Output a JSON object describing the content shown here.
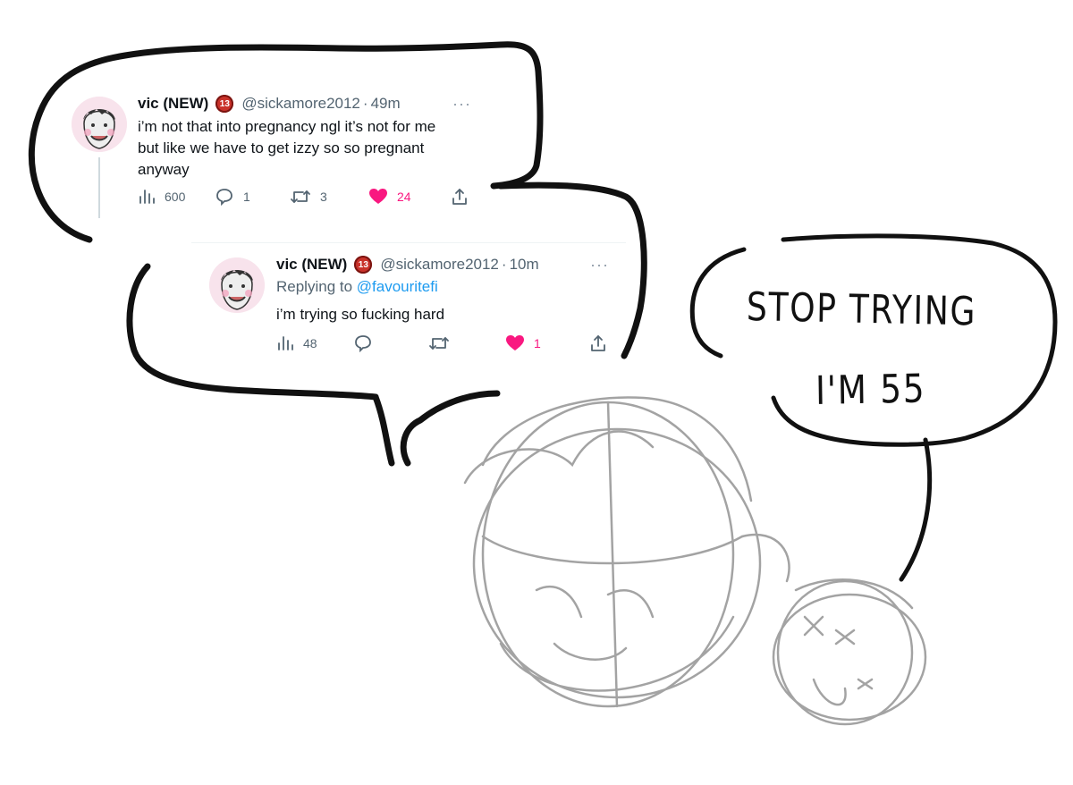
{
  "tweets": [
    {
      "display_name": "vic (NEW)",
      "badge": "13",
      "handle": "@sickamore2012",
      "separator": "·",
      "time": "49m",
      "more": "···",
      "text": "i’m not that into pregnancy ngl it’s not for me but like we have to get izzy so so pregnant anyway",
      "stats": {
        "views": "600",
        "replies": "1",
        "retweets": "3",
        "likes": "24"
      }
    },
    {
      "display_name": "vic (NEW)",
      "badge": "13",
      "handle": "@sickamore2012",
      "separator": "·",
      "time": "10m",
      "more": "···",
      "replying_prefix": "Replying to ",
      "replying_to": "@favouritefi",
      "text": "i’m trying so fucking hard",
      "stats": {
        "views": "48",
        "replies": "",
        "retweets": "",
        "likes": "1"
      }
    }
  ],
  "speech": {
    "line1": "STOP TRYING",
    "line2": "I'M 55"
  },
  "colors": {
    "like": "#f91880",
    "icon": "#536471",
    "mention": "#1d9bf0",
    "badge": "#c9322a",
    "bubble_ink": "#111111",
    "sketch": "#9a9a9a"
  }
}
